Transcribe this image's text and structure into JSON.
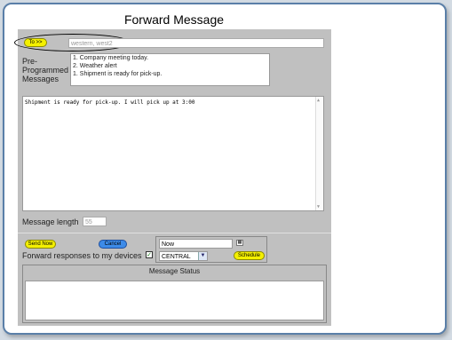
{
  "title": "Forward Message",
  "to": {
    "button_label": "To >>",
    "value": "western, west2"
  },
  "preprogrammed": {
    "label_lines": [
      "Pre-",
      "Programmed",
      "Messages"
    ],
    "items": [
      "1. Company meeting today.",
      "2. Weather alert",
      "1. Shipment is ready for pick-up."
    ]
  },
  "message": {
    "text": "Shipment is ready for pick-up. I will pick up at 3:00"
  },
  "length": {
    "label": "Message length",
    "value": "55"
  },
  "actions": {
    "send_now": "Send Now",
    "cancel": "Cancel",
    "schedule": "Schedule"
  },
  "forward": {
    "label": "Forward responses to my devices",
    "checked_mark": "✓"
  },
  "schedule": {
    "time_value": "Now",
    "timezone": "CENTRAL"
  },
  "status": {
    "title": "Message Status"
  },
  "colors": {
    "yellow_button": "#f4f000",
    "blue_button": "#3d8be8",
    "panel": "#c0c0c0",
    "frame_border": "#5a7fa8"
  }
}
